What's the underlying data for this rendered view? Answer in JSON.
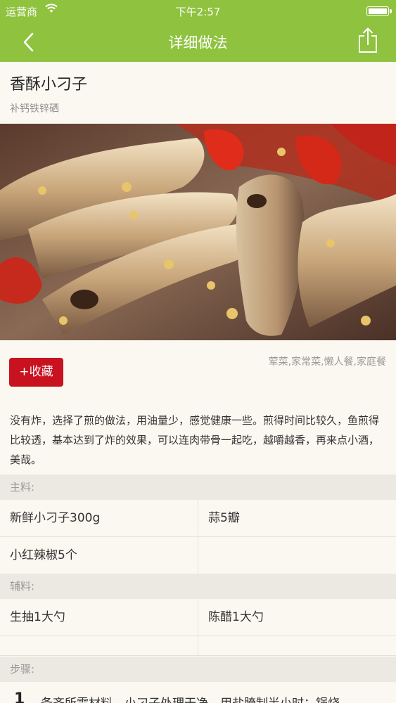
{
  "status_bar": {
    "carrier": "运营商",
    "time": "下午2:57"
  },
  "nav": {
    "title": "详细做法"
  },
  "recipe": {
    "title": "香酥小刁子",
    "subtitle": "补钙铁锌硒",
    "favorite_label": "+收藏",
    "tags": "荤菜,家常菜,懒人餐,家庭餐",
    "description": "没有炸，选择了煎的做法，用油量少，感觉健康一些。煎得时间比较久，鱼煎得比较透，基本达到了炸的效果，可以连肉带骨一起吃，越嚼越香，再来点小酒，美哉。"
  },
  "main_ingredients": {
    "label": "主料:",
    "items": [
      "新鲜小刁子300g",
      "蒜5瓣",
      "小红辣椒5个",
      ""
    ]
  },
  "secondary_ingredients": {
    "label": "辅料:",
    "items": [
      "生抽1大勺",
      "陈醋1大勺",
      "",
      ""
    ]
  },
  "steps": {
    "label": "步骤:",
    "list": [
      {
        "number": "1",
        "text": "备齐所需材料，小刁子处理干净，用盐腌制半小时；锅烧"
      }
    ]
  },
  "colors": {
    "accent": "#8fc23e",
    "favorite_button": "#c81220",
    "section_background": "#ece9e2",
    "page_background": "#fbf8f1"
  },
  "icons": {
    "back": "chevron-left-icon",
    "share": "share-icon",
    "wifi": "wifi-icon",
    "battery": "battery-icon"
  }
}
